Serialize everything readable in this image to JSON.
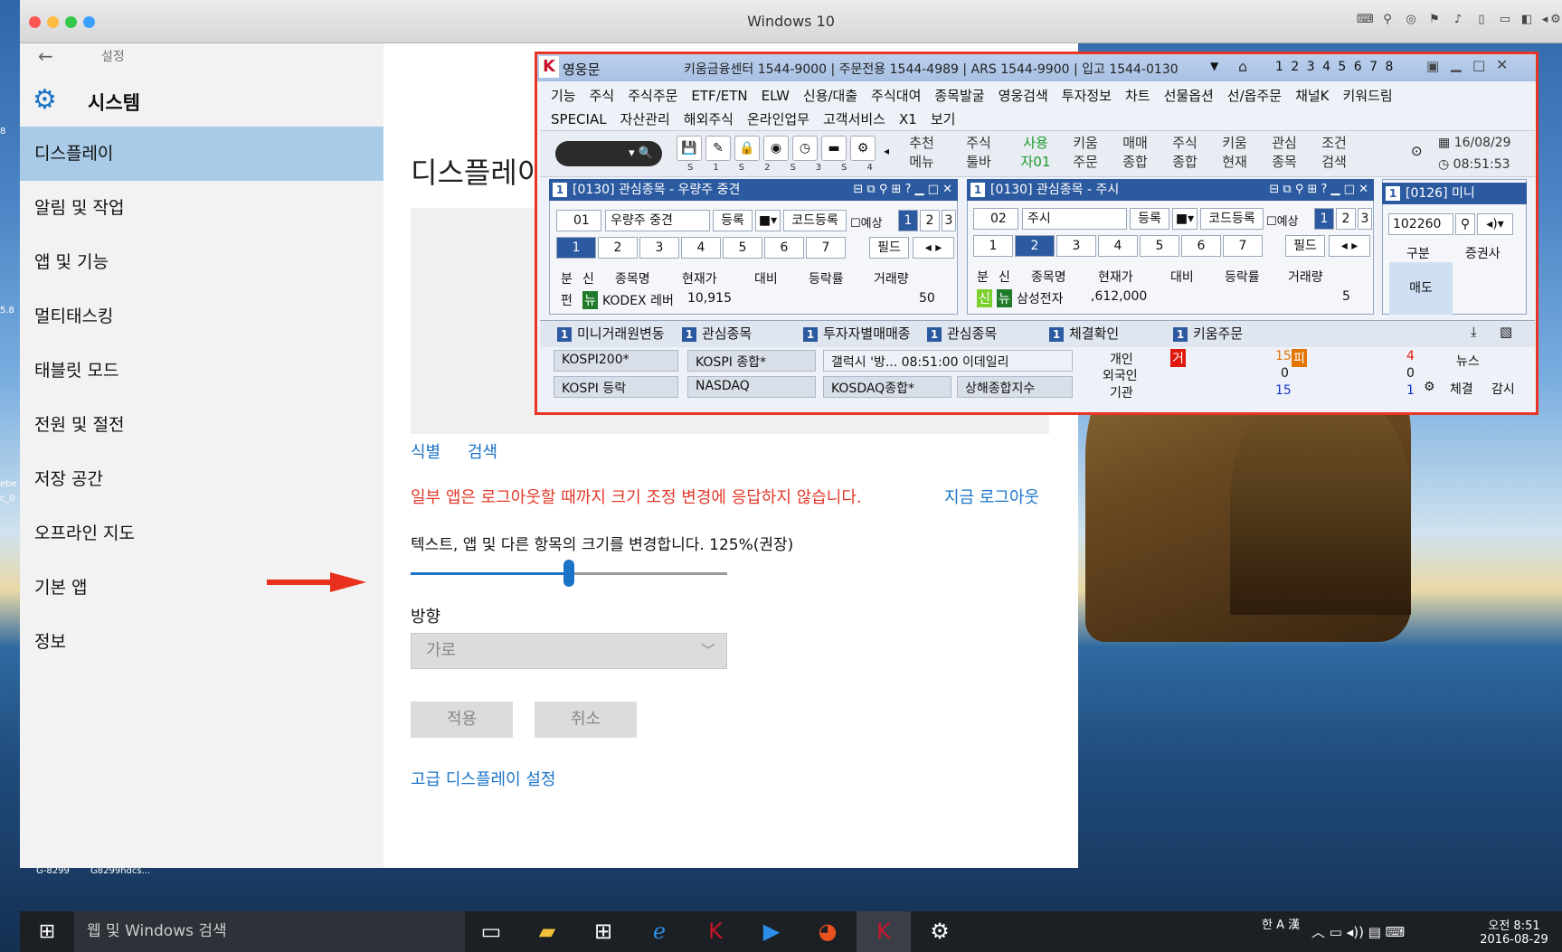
{
  "mac_window": {
    "title": "Windows 10"
  },
  "settings": {
    "header": "설정",
    "section_title": "시스템",
    "nav": [
      "디스플레이",
      "알림 및 작업",
      "앱 및 기능",
      "멀티태스킹",
      "태블릿 모드",
      "전원 및 절전",
      "저장 공간",
      "오프라인 지도",
      "기본 앱",
      "정보"
    ],
    "page_title": "디스플레이",
    "identify_link": "식별",
    "detect_link": "검색",
    "warning": "일부 앱은 로그아웃할 때까지 크기 조정 변경에 응답하지 않습니다.",
    "logout_link": "지금 로그아웃",
    "scale_label": "텍스트, 앱 및 다른 항목의 크기를 변경합니다. 125%(권장)",
    "scale_value": 0.5,
    "orientation_label": "방향",
    "orientation_value": "가로",
    "apply": "적용",
    "cancel": "취소",
    "advanced_link": "고급 디스플레이 설정"
  },
  "taskbar": {
    "search_placeholder": "웹 및 Windows 검색",
    "time": "오전 8:51",
    "date": "2016-08-29",
    "ime": "한 A 漢"
  },
  "desktop_labels": [
    "8",
    "5.8",
    "'플'",
    "ebe",
    "c_0",
    "G-8299",
    "G8299hdcs..."
  ],
  "hts": {
    "app_name": "영웅문",
    "info": "키움금융센터 1544-9000 | 주문전용 1544-4989 | ARS 1544-9900 | 입고 1544-0130",
    "screen_numbers": "1 2 3 4 5 6 7 8",
    "menu1": [
      "기능",
      "주식",
      "주식주문",
      "ETF/ETN",
      "ELW",
      "신용/대출",
      "주식대여",
      "종목발굴",
      "영웅검색",
      "투자정보",
      "차트",
      "선물옵션",
      "선/옵주문",
      "채널K",
      "키워드림"
    ],
    "menu2": [
      "SPECIAL",
      "자산관리",
      "해외주식",
      "온라인업무",
      "고객서비스",
      "X1",
      "보기"
    ],
    "toolbar_labels": [
      "S1",
      "S2",
      "S3",
      "S4"
    ],
    "toolbar_buttons": [
      [
        "추천",
        "메뉴"
      ],
      [
        "주식",
        "툴바"
      ],
      [
        "사용",
        "자01"
      ],
      [
        "키움",
        "주문"
      ],
      [
        "매매",
        "종합"
      ],
      [
        "주식",
        "종합"
      ],
      [
        "키움",
        "현재"
      ],
      [
        "관심",
        "종목"
      ],
      [
        "조건",
        "검색"
      ]
    ],
    "date": "16/08/29",
    "time": "08:51:53",
    "panel1": {
      "num": "1",
      "title": "[0130] 관심종목 - 우량주 중견",
      "group_no": "01",
      "group_name": "우량주 중견",
      "register": "등록",
      "code_register": "코드등록",
      "forecast": "예상",
      "pages": [
        "1",
        "2",
        "3"
      ],
      "tabs": [
        "1",
        "2",
        "3",
        "4",
        "5",
        "6",
        "7"
      ],
      "field": "필드",
      "headers": [
        "분",
        "신",
        "종목명",
        "현재가",
        "대비",
        "등락률",
        "거래량"
      ],
      "row_type": "펀",
      "row_tag": "뉴",
      "row_name": "KODEX 레버",
      "row_price": "10,915",
      "row_volume": "50"
    },
    "panel2": {
      "num": "1",
      "title": "[0130] 관심종목 - 주시",
      "group_no": "02",
      "group_name": "주시",
      "register": "등록",
      "code_register": "코드등록",
      "forecast": "예상",
      "pages": [
        "1",
        "2",
        "3"
      ],
      "tabs": [
        "1",
        "2",
        "3",
        "4",
        "5",
        "6",
        "7"
      ],
      "field": "필드",
      "headers": [
        "분",
        "신",
        "종목명",
        "현재가",
        "대비",
        "등락률",
        "거래량"
      ],
      "row_type": "신",
      "row_tag": "뉴",
      "row_name": "삼성전자",
      "row_price": ",612,000",
      "row_volume": "5"
    },
    "panel3": {
      "num": "1",
      "title": "[0126] 미니",
      "code": "102260",
      "headers": [
        "구분",
        "증권사"
      ],
      "side": "매도"
    },
    "bottom_tabs": [
      "미니거래원변동",
      "관심종목",
      "투자자별매매종",
      "관심종목",
      "체결확인",
      "키움주문"
    ],
    "bottom_tab_nums": [
      "1",
      "1",
      "1",
      "1",
      "1",
      "1"
    ],
    "ticker_row1": [
      "KOSPI200*",
      "KOSPI 종합*",
      "갤럭시 '방... 08:51:00  이데일리"
    ],
    "ticker_row2": [
      "KOSPI 등락",
      "NASDAQ",
      "KOSDAQ종합*",
      "상해종합지수"
    ],
    "investors": [
      "개인",
      "외국인",
      "기관"
    ],
    "flag": "거",
    "inv_values": [
      "15",
      "0",
      "15"
    ],
    "inv_values2": [
      "4",
      "0",
      "1"
    ],
    "inv_badge": "피",
    "news": "뉴스",
    "fill": "체결",
    "watch": "감시"
  }
}
